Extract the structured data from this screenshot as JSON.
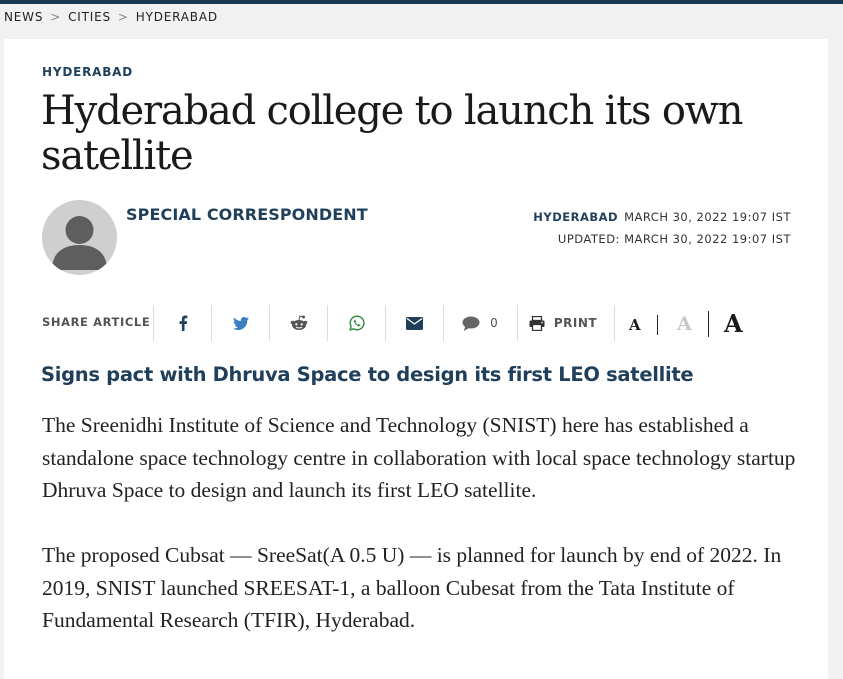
{
  "breadcrumb": {
    "items": [
      "NEWS",
      "CITIES",
      "HYDERABAD"
    ],
    "separator": ">"
  },
  "article": {
    "section": "HYDERABAD",
    "title": "Hyderabad college to launch its own satellite",
    "author": "SPECIAL CORRESPONDENT",
    "dateline": {
      "location": "HYDERABAD",
      "published": "MARCH 30, 2022 19:07 IST",
      "updated": "UPDATED: MARCH 30, 2022 19:07 IST"
    },
    "subheading": "Signs pact with Dhruva Space to design its first LEO satellite",
    "paragraphs": [
      "The Sreenidhi Institute of Science and Technology (SNIST) here has established a standalone space technology centre in collaboration with local space technology startup Dhruva Space to design and launch its first LEO satellite.",
      "The proposed Cubsat — SreeSat(A 0.5 U) — is planned for launch by end of 2022. In 2019, SNIST launched SREESAT-1, a balloon Cubesat from the Tata Institute of Fundamental Research (TFIR), Hyderabad."
    ]
  },
  "share": {
    "label": "SHARE ARTICLE",
    "buttons": [
      "facebook-icon",
      "twitter-icon",
      "reddit-icon",
      "whatsapp-icon",
      "email-icon",
      "comment-icon"
    ],
    "comment_count": "0",
    "print_label": "PRINT"
  },
  "font_size": {
    "small": "A",
    "medium": "A",
    "large": "A"
  },
  "colors": {
    "brand_navy": "#1f3f5a",
    "top_bar": "#1b3a52",
    "background": "#f1f1f1"
  }
}
